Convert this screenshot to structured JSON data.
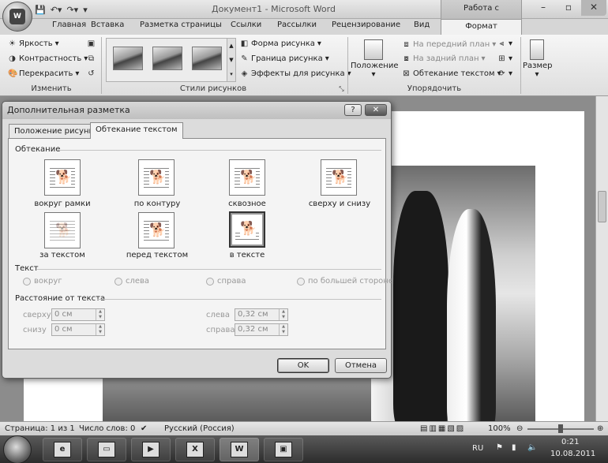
{
  "window": {
    "title": "Документ1 - Microsoft Word",
    "context_group": "Работа с рисунками",
    "office_button": "W"
  },
  "tabs": [
    "Главная",
    "Вставка",
    "Разметка страницы",
    "Ссылки",
    "Рассылки",
    "Рецензирование",
    "Вид"
  ],
  "active_tab": "Формат",
  "ribbon": {
    "adjust": {
      "brightness": "Яркость",
      "contrast": "Контрастность",
      "recolor": "Перекрасить",
      "label": "Изменить"
    },
    "styles": {
      "shape": "Форма рисунка",
      "border": "Граница рисунка",
      "effects": "Эффекты для рисунка",
      "label": "Стили рисунков"
    },
    "arrange": {
      "position": "Положение",
      "bring_front": "На передний план",
      "send_back": "На задний план",
      "text_wrap": "Обтекание текстом",
      "label": "Упорядочить"
    },
    "size": {
      "label": "Размер"
    }
  },
  "dialog": {
    "title": "Дополнительная разметка",
    "help": "?",
    "close": "✕",
    "tabs": [
      "Положение рисунка",
      "Обтекание текстом"
    ],
    "wrap_section": "Обтекание",
    "wrap_options": [
      "вокруг рамки",
      "по контуру",
      "сквозное",
      "сверху и снизу",
      "за текстом",
      "перед текстом",
      "в тексте"
    ],
    "text_section": "Текст",
    "text_options": [
      "вокруг",
      "слева",
      "справа",
      "по большей стороне"
    ],
    "distance_section": "Расстояние от текста",
    "distance": {
      "top_label": "сверху",
      "top_value": "0 см",
      "bottom_label": "снизу",
      "bottom_value": "0 см",
      "left_label": "слева",
      "left_value": "0,32 см",
      "right_label": "справа",
      "right_value": "0,32 см"
    },
    "ok": "OK",
    "cancel": "Отмена"
  },
  "status": {
    "page": "Страница: 1 из 1",
    "words": "Число слов: 0",
    "language": "Русский (Россия)",
    "zoom": "100%"
  },
  "taskbar": {
    "lang": "RU",
    "time": "0:21",
    "date": "10.08.2011"
  }
}
